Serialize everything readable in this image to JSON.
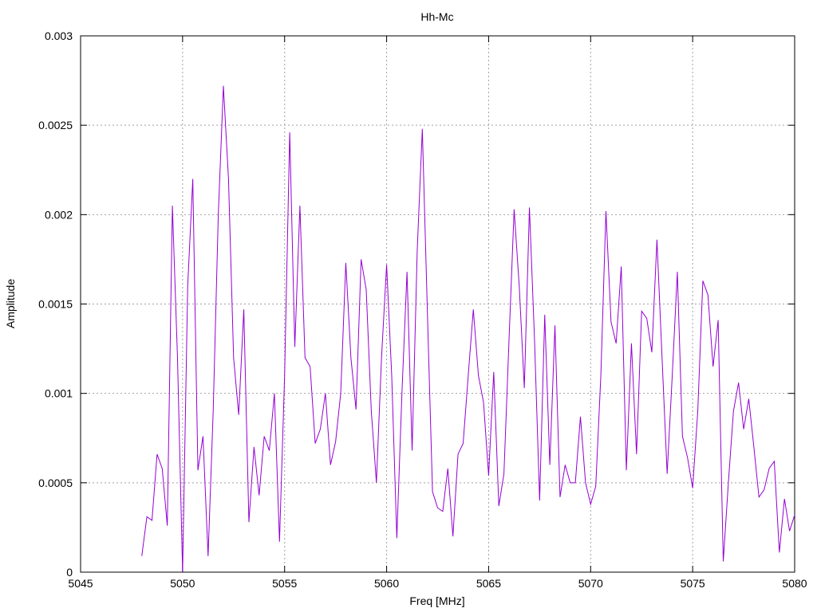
{
  "chart_data": {
    "type": "line",
    "title": "Hh-Mc",
    "xlabel": "Freq [MHz]",
    "ylabel": "Amplitude",
    "xlim": [
      5045,
      5080
    ],
    "ylim": [
      0,
      0.003
    ],
    "x_ticks": [
      5045,
      5050,
      5055,
      5060,
      5065,
      5070,
      5075,
      5080
    ],
    "x_tick_labels": [
      "5045",
      "5050",
      "5055",
      "5060",
      "5065",
      "5070",
      "5075",
      "5080"
    ],
    "y_ticks": [
      0,
      0.0005,
      0.001,
      0.0015,
      0.002,
      0.0025,
      0.003
    ],
    "y_tick_labels": [
      "0",
      "0.0005",
      "0.001",
      "0.0015",
      "0.002",
      "0.0025",
      "0.003"
    ],
    "grid": true,
    "line_color": "#9400d3",
    "series": [
      {
        "x": [
          5048.0,
          5048.25,
          5048.5,
          5048.75,
          5049.0,
          5049.25,
          5049.5,
          5049.75,
          5050.0,
          5050.25,
          5050.5,
          5050.75,
          5051.0,
          5051.25,
          5051.5,
          5051.75,
          5052.0,
          5052.25,
          5052.5,
          5052.75,
          5053.0,
          5053.25,
          5053.5,
          5053.75,
          5054.0,
          5054.25,
          5054.5,
          5054.75,
          5055.0,
          5055.25,
          5055.5,
          5055.75,
          5056.0,
          5056.25,
          5056.5,
          5056.75,
          5057.0,
          5057.25,
          5057.5,
          5057.75,
          5058.0,
          5058.25,
          5058.5,
          5058.75,
          5059.0,
          5059.25,
          5059.5,
          5059.75,
          5060.0,
          5060.25,
          5060.5,
          5060.75,
          5061.0,
          5061.25,
          5061.5,
          5061.75,
          5062.0,
          5062.25,
          5062.5,
          5062.75,
          5063.0,
          5063.25,
          5063.5,
          5063.75,
          5064.0,
          5064.25,
          5064.5,
          5064.75,
          5065.0,
          5065.25,
          5065.5,
          5065.75,
          5066.0,
          5066.25,
          5066.5,
          5066.75,
          5067.0,
          5067.25,
          5067.5,
          5067.75,
          5068.0,
          5068.25,
          5068.5,
          5068.75,
          5069.0,
          5069.25,
          5069.5,
          5069.75,
          5070.0,
          5070.25,
          5070.5,
          5070.75,
          5071.0,
          5071.25,
          5071.5,
          5071.75,
          5072.0,
          5072.25,
          5072.5,
          5072.75,
          5073.0,
          5073.25,
          5073.5,
          5073.75,
          5074.0,
          5074.25,
          5074.5,
          5074.75,
          5075.0,
          5075.25,
          5075.5,
          5075.75,
          5076.0,
          5076.25,
          5076.5,
          5076.75,
          5077.0,
          5077.25,
          5077.5,
          5077.75,
          5078.0,
          5078.25,
          5078.5,
          5078.75,
          5079.0,
          5079.25,
          5079.5,
          5079.75,
          5080.0
        ],
        "values": [
          9e-05,
          0.00031,
          0.00029,
          0.00066,
          0.00058,
          0.00026,
          0.00205,
          0.0012,
          0.0,
          0.0016,
          0.0022,
          0.00057,
          0.00076,
          9e-05,
          0.0009,
          0.002,
          0.00272,
          0.0022,
          0.0012,
          0.00088,
          0.00147,
          0.00028,
          0.0007,
          0.00043,
          0.00076,
          0.00068,
          0.001,
          0.00017,
          0.0011,
          0.00246,
          0.00126,
          0.00205,
          0.0012,
          0.00115,
          0.00072,
          0.0008,
          0.001,
          0.0006,
          0.00073,
          0.001,
          0.00173,
          0.0012,
          0.00091,
          0.00175,
          0.00158,
          0.0009,
          0.0005,
          0.0012,
          0.00172,
          0.0011,
          0.00019,
          0.001,
          0.00168,
          0.00068,
          0.0018,
          0.00248,
          0.00145,
          0.00045,
          0.00036,
          0.00034,
          0.00058,
          0.0002,
          0.00066,
          0.00072,
          0.0011,
          0.00147,
          0.0011,
          0.00095,
          0.00054,
          0.00112,
          0.00037,
          0.00055,
          0.0013,
          0.00203,
          0.0016,
          0.00103,
          0.00204,
          0.0013,
          0.0004,
          0.00144,
          0.0006,
          0.00138,
          0.00042,
          0.0006,
          0.0005,
          0.0005,
          0.00087,
          0.0005,
          0.00038,
          0.00048,
          0.0011,
          0.00202,
          0.0014,
          0.00128,
          0.00171,
          0.00057,
          0.00128,
          0.00066,
          0.00146,
          0.00142,
          0.00123,
          0.00186,
          0.0012,
          0.00055,
          0.0011,
          0.00168,
          0.00076,
          0.00064,
          0.00047,
          0.0009,
          0.00163,
          0.00155,
          0.00115,
          0.00141,
          6e-05,
          0.0005,
          0.0009,
          0.00106,
          0.0008,
          0.00097,
          0.0007,
          0.00042,
          0.00046,
          0.00058,
          0.00062,
          0.00011,
          0.00041,
          0.00023,
          0.00032
        ]
      }
    ]
  }
}
